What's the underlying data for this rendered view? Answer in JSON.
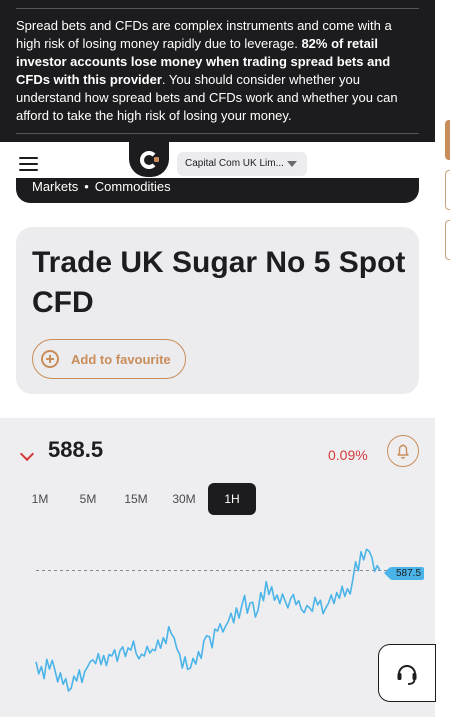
{
  "risk_warning": {
    "text_plain_1": "Spread bets and CFDs are complex instruments and come with a high risk of losing money rapidly due to leverage. ",
    "text_bold": "82% of retail investor accounts lose money when trading spread bets and CFDs with this provider",
    "text_plain_2": ". You should consider whether you understand how spread bets and CFDs work and whether you can afford to take the high risk of losing your money."
  },
  "header": {
    "entity_select": "Capital Com UK Lim..."
  },
  "breadcrumb": {
    "items": [
      "Markets",
      "Commodities"
    ],
    "separator": "•"
  },
  "instrument": {
    "title": "Trade UK Sugar No 5 Spot CFD",
    "favourite_label": "Add to favourite"
  },
  "quote": {
    "price": "588.5",
    "change": "0.09%",
    "direction": "down"
  },
  "timeframes": [
    {
      "label": "1M",
      "active": false
    },
    {
      "label": "5M",
      "active": false
    },
    {
      "label": "15M",
      "active": false
    },
    {
      "label": "30M",
      "active": false
    },
    {
      "label": "1H",
      "active": true
    }
  ],
  "chart_data": {
    "type": "line",
    "current_price_label": "587.5",
    "current_price": 587.5,
    "ylim": [
      557,
      598
    ],
    "values": [
      568.5,
      566,
      567.5,
      565,
      569,
      567,
      568.8,
      566.7,
      564.3,
      566.2,
      563.8,
      565,
      562.4,
      563,
      565.5,
      564.5,
      566.8,
      564.2,
      566.5,
      567.4,
      568.5,
      568.9,
      568.1,
      570.2,
      567.9,
      569.8,
      567.7,
      570,
      569.7,
      571,
      568.6,
      570.8,
      571.6,
      569.6,
      571.4,
      570.9,
      572.8,
      570.2,
      569.1,
      570.1,
      569.7,
      571.7,
      570.3,
      571.1,
      570.8,
      573,
      571.3,
      573.5,
      572.3,
      575.8,
      574.3,
      573.5,
      571.2,
      570.1,
      567.2,
      569.5,
      566.9,
      567.2,
      569.2,
      568,
      570.6,
      569.2,
      572.9,
      573.9,
      573.7,
      571.4,
      575.3,
      574.9,
      576.4,
      574.7,
      575.9,
      576.9,
      578.6,
      576.6,
      579.7,
      577.6,
      580.3,
      582.3,
      578.6,
      580.7,
      580.9,
      577.8,
      579.3,
      582.9,
      581.2,
      585.2,
      582.5,
      584.1,
      581.3,
      582.4,
      580.6,
      582.6,
      581.1,
      579.7,
      581.6,
      582.5,
      580.4,
      581.2,
      579.4,
      578.7,
      580.2,
      579.7,
      579,
      581.9,
      580.3,
      581.3,
      578.5,
      579.7,
      580.7,
      582.4,
      580.6,
      582.9,
      581.7,
      584.2,
      582.1,
      583.7,
      582.6,
      585.7,
      589.3,
      587.4,
      591.4,
      589.7,
      591.9,
      591.5,
      590.2,
      587.3,
      588.5,
      587.5
    ]
  }
}
